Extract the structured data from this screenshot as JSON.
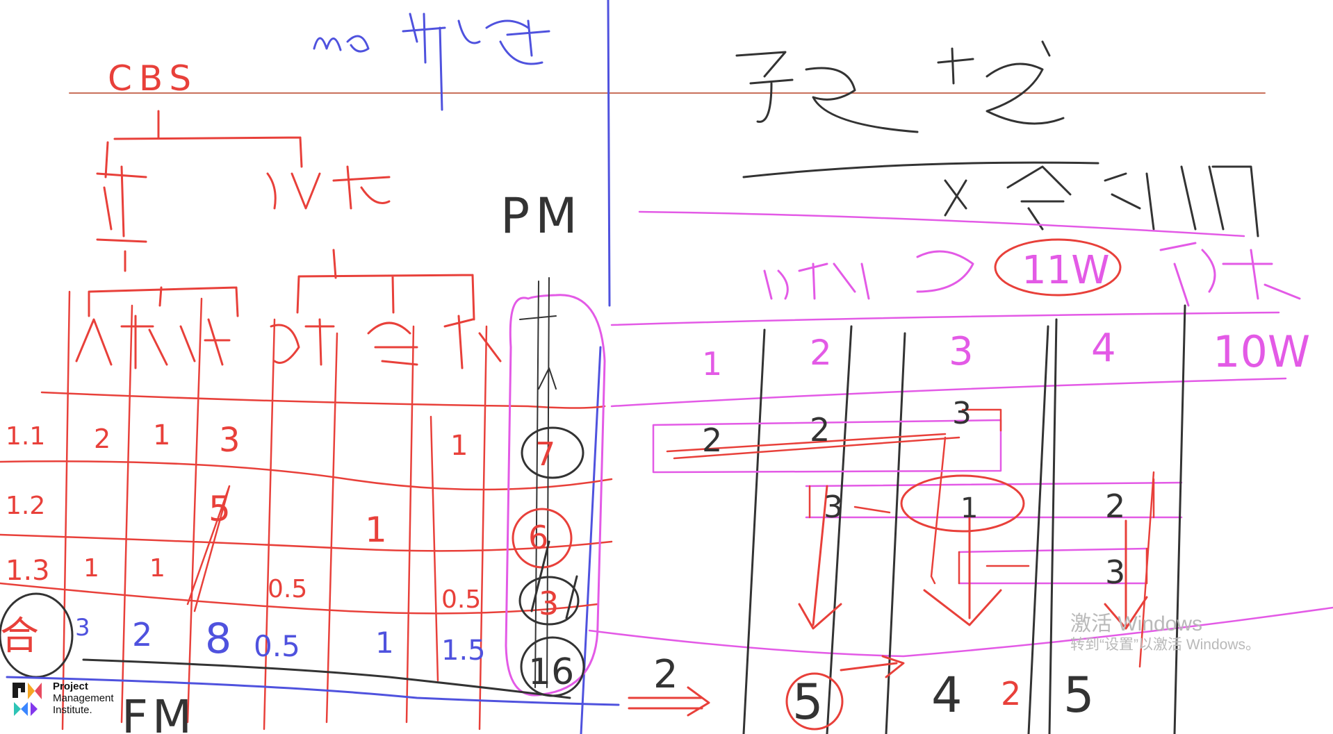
{
  "colors": {
    "red": "#e8403a",
    "black": "#333333",
    "blue": "#4f52de",
    "magenta": "#e35ae6",
    "watermark": "#b9b9b9"
  },
  "left": {
    "cbs_label": "CBS",
    "pm_label": "PM",
    "fm_label": "FM",
    "rows": [
      {
        "label": "1.1",
        "values": [
          "2",
          "1",
          "3",
          "",
          "",
          "1"
        ],
        "total": "7"
      },
      {
        "label": "1.2",
        "values": [
          "",
          "",
          "5",
          "",
          "1",
          ""
        ],
        "total": "6"
      },
      {
        "label": "1.3",
        "values": [
          "1",
          "1",
          "",
          "0.5",
          "",
          "0.5"
        ],
        "total": "3"
      }
    ],
    "sum_values": [
      "3",
      "2",
      "8",
      "0.5",
      "1",
      "1.5"
    ],
    "grand_total": "16"
  },
  "right": {
    "time_values": [
      "1",
      "2",
      "3",
      "4"
    ],
    "total_10w": "10W",
    "circled_11w": "11W",
    "bars": [
      "2",
      "2",
      "3",
      "3",
      "1",
      "2",
      "3"
    ],
    "bottom_values": [
      "2",
      "5",
      "4",
      "2",
      "5"
    ]
  },
  "watermark": {
    "line1": "激活 Windows",
    "line2": "转到“设置”以激活 Windows。"
  },
  "logo": {
    "line1": "Project",
    "line2": "Management",
    "line3": "Institute."
  }
}
